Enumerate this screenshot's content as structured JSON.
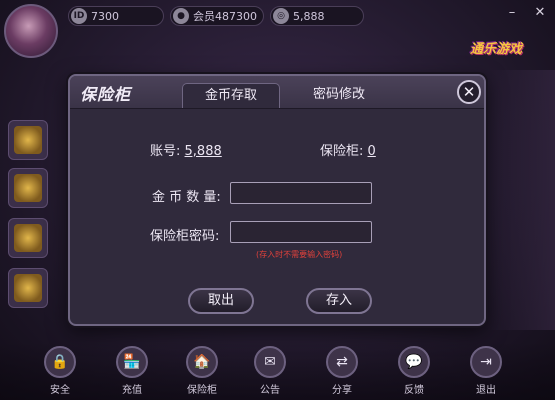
{
  "topbar": {
    "id_icon": "ID",
    "id_value": "7300",
    "member_value": "会员487300",
    "coins_value": "5,888",
    "minimize_glyph": "–",
    "close_glyph": "✕"
  },
  "logo_text": "通乐游戏",
  "dialog": {
    "title": "保险柜",
    "tabs": [
      {
        "label": "金币存取",
        "active": true
      },
      {
        "label": "密码修改",
        "active": false
      }
    ],
    "close_glyph": "✕",
    "account_label": "账号:",
    "account_value": "5,888",
    "safe_label": "保险柜:",
    "safe_value": "0",
    "amount_label": "金 币 数 量:",
    "amount_value": "",
    "password_label": "保险柜密码:",
    "password_value": "",
    "hint": "(存入时不需要输入密码)",
    "withdraw_button": "取出",
    "deposit_button": "存入"
  },
  "bottombar": {
    "items": [
      {
        "label": "安全",
        "icon": "lock-icon",
        "glyph": "🔒"
      },
      {
        "label": "充值",
        "icon": "shop-icon",
        "glyph": "🏪"
      },
      {
        "label": "保险柜",
        "icon": "safe-icon",
        "glyph": "🏠"
      },
      {
        "label": "公告",
        "icon": "mail-icon",
        "glyph": "✉"
      },
      {
        "label": "分享",
        "icon": "share-icon",
        "glyph": "⇄"
      },
      {
        "label": "反馈",
        "icon": "chat-icon",
        "glyph": "💬"
      },
      {
        "label": "退出",
        "icon": "exit-icon",
        "glyph": "⇥"
      }
    ]
  },
  "colors": {
    "dialog_bg": "#302a3c",
    "hint_red": "#e0413b",
    "logo_gold": "#f5c542"
  }
}
